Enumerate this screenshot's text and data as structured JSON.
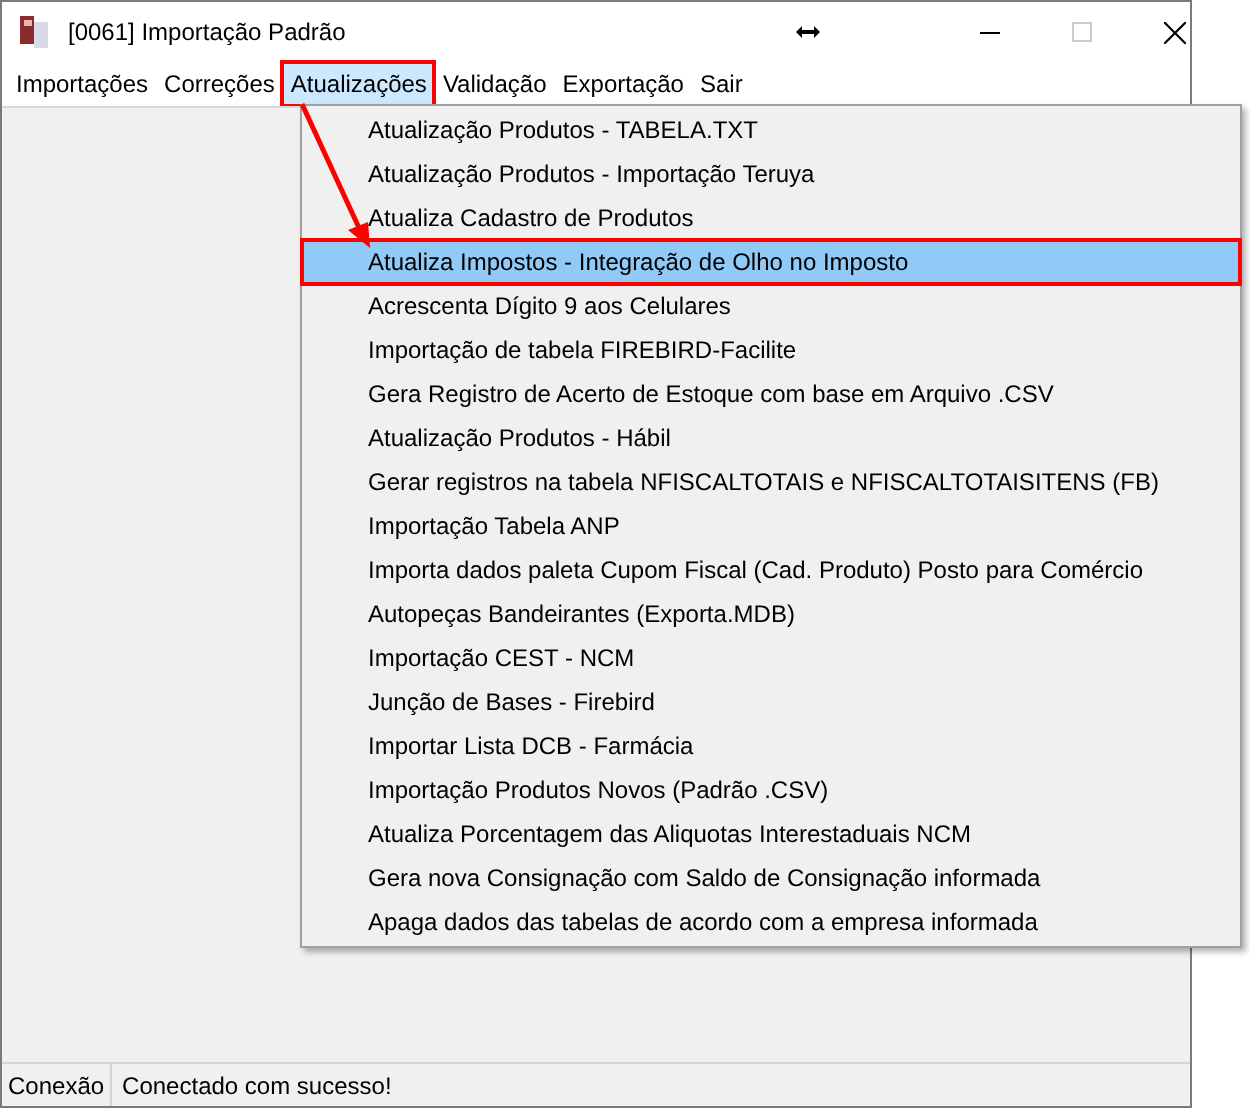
{
  "window": {
    "title": "[0061] Importação Padrão"
  },
  "menu": [
    {
      "label": "Importações",
      "selected": false
    },
    {
      "label": "Correções",
      "selected": false
    },
    {
      "label": "Atualizações",
      "selected": true
    },
    {
      "label": "Validação",
      "selected": false
    },
    {
      "label": "Exportação",
      "selected": false
    },
    {
      "label": "Sair",
      "selected": false
    }
  ],
  "dropdown": [
    {
      "label": "Atualização Produtos - TABELA.TXT",
      "selected": false
    },
    {
      "label": "Atualização Produtos - Importação Teruya",
      "selected": false
    },
    {
      "label": "Atualiza Cadastro de Produtos",
      "selected": false
    },
    {
      "label": "Atualiza Impostos - Integração de Olho no Imposto",
      "selected": true
    },
    {
      "label": "Acrescenta Dígito 9 aos Celulares",
      "selected": false
    },
    {
      "label": "Importação de tabela FIREBIRD-Facilite",
      "selected": false
    },
    {
      "label": "Gera Registro de Acerto de Estoque com base em Arquivo .CSV",
      "selected": false
    },
    {
      "label": "Atualização Produtos - Hábil",
      "selected": false
    },
    {
      "label": "Gerar registros na tabela NFISCALTOTAIS e NFISCALTOTAISITENS (FB)",
      "selected": false
    },
    {
      "label": "Importação Tabela ANP",
      "selected": false
    },
    {
      "label": "Importa dados paleta Cupom Fiscal (Cad. Produto) Posto para Comércio",
      "selected": false
    },
    {
      "label": "Autopeças Bandeirantes (Exporta.MDB)",
      "selected": false
    },
    {
      "label": "Importação CEST - NCM",
      "selected": false
    },
    {
      "label": "Junção de Bases - Firebird",
      "selected": false
    },
    {
      "label": "Importar Lista DCB - Farmácia",
      "selected": false
    },
    {
      "label": "Importação Produtos Novos (Padrão .CSV)",
      "selected": false
    },
    {
      "label": "Atualiza Porcentagem das Aliquotas Interestaduais NCM",
      "selected": false
    },
    {
      "label": "Gera nova Consignação com Saldo de Consignação informada",
      "selected": false
    },
    {
      "label": "Apaga dados das tabelas de acordo com a empresa informada",
      "selected": false
    }
  ],
  "status_bar": {
    "label": "Conexão",
    "message": "Conectado com sucesso!"
  }
}
